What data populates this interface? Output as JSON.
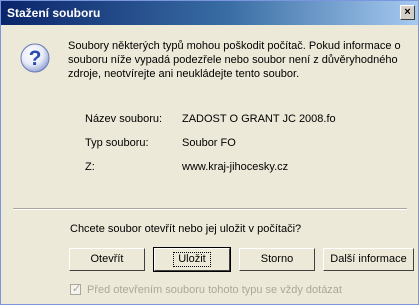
{
  "window": {
    "title": "Stažení souboru",
    "close_glyph": "×"
  },
  "message": "Soubory některých typů mohou poškodit počítač. Pokud informace o souboru níže vypadá podezřele nebo soubor není z důvěryhodného zdroje, neotvírejte ani neukládejte tento soubor.",
  "icon": {
    "name": "help-icon",
    "color": "#2a4bb0"
  },
  "file_info": {
    "name_label": "Název souboru:",
    "name_value": "ZADOST O GRANT JC 2008.fo",
    "type_label": "Typ souboru:",
    "type_value": "Soubor FO",
    "from_label": "Z:",
    "from_value": "www.kraj-jihocesky.cz"
  },
  "question": "Chcete soubor otevřít nebo jej uložit v počítači?",
  "buttons": {
    "open": "Otevřít",
    "save": "Uložit",
    "cancel": "Storno",
    "more": "Další informace"
  },
  "checkbox": {
    "label": "Před otevřením souboru tohoto typu se vždy dotázat",
    "checked": true,
    "disabled": true
  }
}
